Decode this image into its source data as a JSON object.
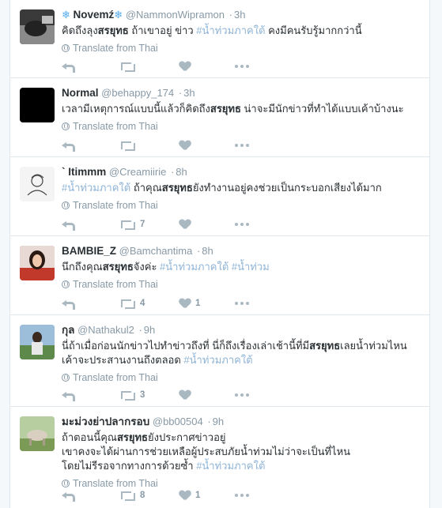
{
  "translate_label": "Translate from Thai",
  "tweets": [
    {
      "fullname": "Novemź",
      "username": "@NammonWipramon",
      "time": "3h",
      "text_parts": [
        {
          "t": "คิดถึงลุง",
          "s": "n"
        },
        {
          "t": "สรยุทธ",
          "s": "b"
        },
        {
          "t": " ถ้าเขาอยู่ ข่าว ",
          "s": "n"
        },
        {
          "t": "#น้ำท่วมภาคใต้",
          "s": "h"
        },
        {
          "t": " คงมีคนรับรู้มากกว่านี้",
          "s": "n"
        }
      ],
      "retweets": "",
      "likes": "",
      "avatar": "novem"
    },
    {
      "fullname": "Normal",
      "username": "@behappy_174",
      "time": "3h",
      "text_parts": [
        {
          "t": "เวลามีเหตุการณ์แบบนี้แล้วก็คิดถึง",
          "s": "n"
        },
        {
          "t": "สรยุทธ",
          "s": "b"
        },
        {
          "t": " น่าจะมีนักข่าวที่ทำได้แบบเค้าบ้างนะ",
          "s": "n"
        }
      ],
      "retweets": "",
      "likes": "",
      "avatar": "normal"
    },
    {
      "fullname": "` Itimmm",
      "username": "@Creamiirie",
      "time": "8h",
      "text_parts": [
        {
          "t": "#น้ำท่วมภาคใต้",
          "s": "h"
        },
        {
          "t": " ถ้าคุณ",
          "s": "n"
        },
        {
          "t": "สรยุทธ",
          "s": "b"
        },
        {
          "t": "ยังทำงานอยู่คงช่วยเป็นกระบอกเสียงได้มาก",
          "s": "n"
        }
      ],
      "retweets": "7",
      "likes": "",
      "avatar": "itimmm"
    },
    {
      "fullname": "BAMBIE_Z",
      "username": "@Bamchantima",
      "time": "8h",
      "text_parts": [
        {
          "t": "นึกถึงคุณ",
          "s": "n"
        },
        {
          "t": "สรยุทธ",
          "s": "b"
        },
        {
          "t": "จังค่ะ ",
          "s": "n"
        },
        {
          "t": "#น้ำท่วมภาคใต้",
          "s": "h"
        },
        {
          "t": " ",
          "s": "n"
        },
        {
          "t": "#น้ำท่วม",
          "s": "h"
        }
      ],
      "retweets": "4",
      "likes": "1",
      "avatar": "bambie"
    },
    {
      "fullname": "กุล",
      "username": "@Nathakul2",
      "time": "9h",
      "text_parts": [
        {
          "t": "นี่ถ้าเมื่อก่อนนักข่าวไปทำข่าวถึงที่ นี่ก็ถึงเรื่องเล่าเช้านี้ที่มี",
          "s": "n"
        },
        {
          "t": "สรยุทธ",
          "s": "b"
        },
        {
          "t": "เลยน้ำท่วมไหนเค้าจะประสานงานถึงตลอด ",
          "s": "n"
        },
        {
          "t": "#น้ำท่วมภาคใต้",
          "s": "h"
        }
      ],
      "retweets": "3",
      "likes": "",
      "avatar": "kul"
    },
    {
      "fullname": "มะม่วงย่าปลากรอบ",
      "username": "@bb00504",
      "time": "9h",
      "text_parts": [
        {
          "t": "ถ้าตอนนี้คุณ",
          "s": "n"
        },
        {
          "t": "สรยุทธ",
          "s": "b"
        },
        {
          "t": "ยังประกาศข่าวอยู่\nเขาคงจะได้ผ่านการช่วยเหลือผู้ประสบภัยน้ำท่วมไม่ว่าจะเป็นที่ไหน\nโดยไม่รีรอจากทางการด้วยซ้ำ ",
          "s": "n"
        },
        {
          "t": "#น้ำท่วมภาคใต้",
          "s": "h"
        }
      ],
      "retweets": "8",
      "likes": "1",
      "avatar": "mamuang"
    }
  ]
}
